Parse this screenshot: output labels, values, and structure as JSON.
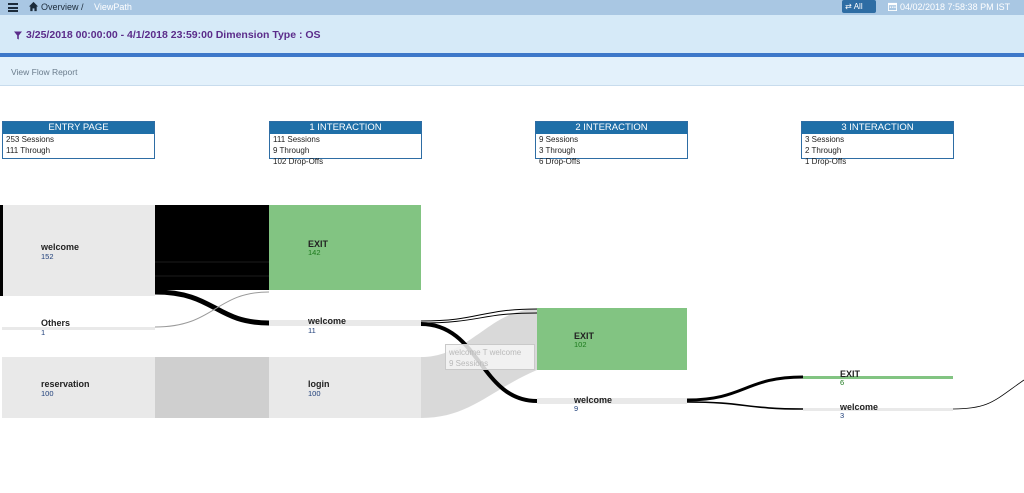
{
  "header": {
    "breadcrumb_home": "Overview /",
    "breadcrumb_current": "ViewPath",
    "all_button": "All",
    "datetime": "04/02/2018 7:58:38 PM IST"
  },
  "filter": {
    "text": "3/25/2018 00:00:00 - 4/1/2018 23:59:00 Dimension Type : OS"
  },
  "subnav": {
    "link": "View Flow Report"
  },
  "columns": [
    {
      "title": "ENTRY PAGE",
      "lines": [
        "253 Sessions",
        "111 Through"
      ]
    },
    {
      "title": "1 INTERACTION",
      "lines": [
        "111 Sessions",
        "9 Through",
        "102 Drop-Offs"
      ]
    },
    {
      "title": "2 INTERACTION",
      "lines": [
        "9 Sessions",
        "3 Through",
        "6 Drop-Offs"
      ]
    },
    {
      "title": "3 INTERACTION",
      "lines": [
        "3 Sessions",
        "2 Through",
        "1 Drop-Offs"
      ]
    }
  ],
  "nodes": {
    "entry_welcome": {
      "label": "welcome",
      "count": "152"
    },
    "entry_others": {
      "label": "Others",
      "count": "1"
    },
    "entry_reservation": {
      "label": "reservation",
      "count": "100"
    },
    "i1_exit": {
      "label": "EXIT",
      "count": "142"
    },
    "i1_welcome": {
      "label": "welcome",
      "count": "11"
    },
    "i1_login": {
      "label": "login",
      "count": "100"
    },
    "i2_exit": {
      "label": "EXIT",
      "count": "102"
    },
    "i2_welcome": {
      "label": "welcome",
      "count": "9"
    },
    "i3_exit": {
      "label": "EXIT",
      "count": "6"
    },
    "i3_welcome": {
      "label": "welcome",
      "count": "3"
    }
  },
  "tooltip": {
    "line1": "welcome T welcome",
    "line2": "9 Sessions"
  },
  "colors": {
    "exit_node": "#82c482",
    "node_grey": "#e9e9e9",
    "link_dark": "#000000",
    "column_header": "#1f6fa8",
    "filter_text": "#5b2c8a"
  }
}
